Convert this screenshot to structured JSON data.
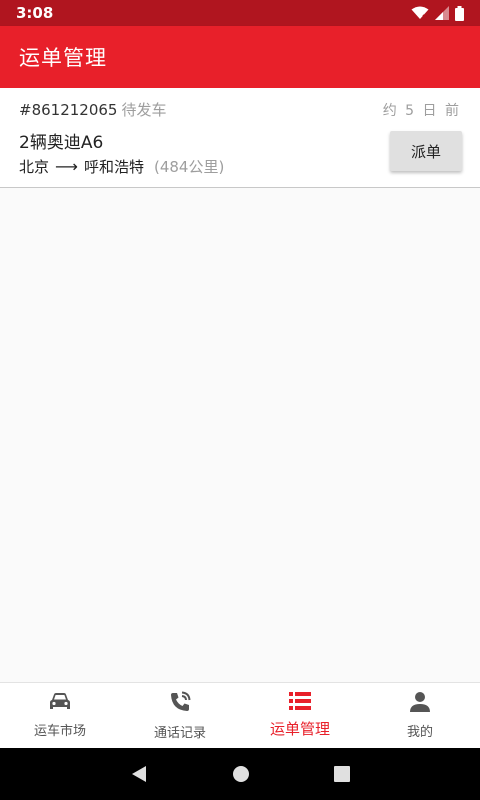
{
  "status_bar": {
    "time": "3:08"
  },
  "app_bar": {
    "title": "运单管理"
  },
  "order": {
    "number": "#861212065",
    "status": "待发车",
    "time_ago": "约 5 日 前",
    "vehicle": "2辆奥迪A6",
    "origin": "北京",
    "arrow": "⟶",
    "destination": "呼和浩特",
    "distance": "(484公里)",
    "dispatch_label": "派单"
  },
  "bottom_nav": {
    "items": [
      {
        "label": "运车市场",
        "icon": "car-icon"
      },
      {
        "label": "通话记录",
        "icon": "phone-call-icon"
      },
      {
        "label": "运单管理",
        "icon": "list-icon",
        "active": true
      },
      {
        "label": "我的",
        "icon": "person-icon"
      }
    ]
  },
  "colors": {
    "status_bar": "#b0151f",
    "app_bar": "#e8202a",
    "active_nav": "#e8202a"
  }
}
